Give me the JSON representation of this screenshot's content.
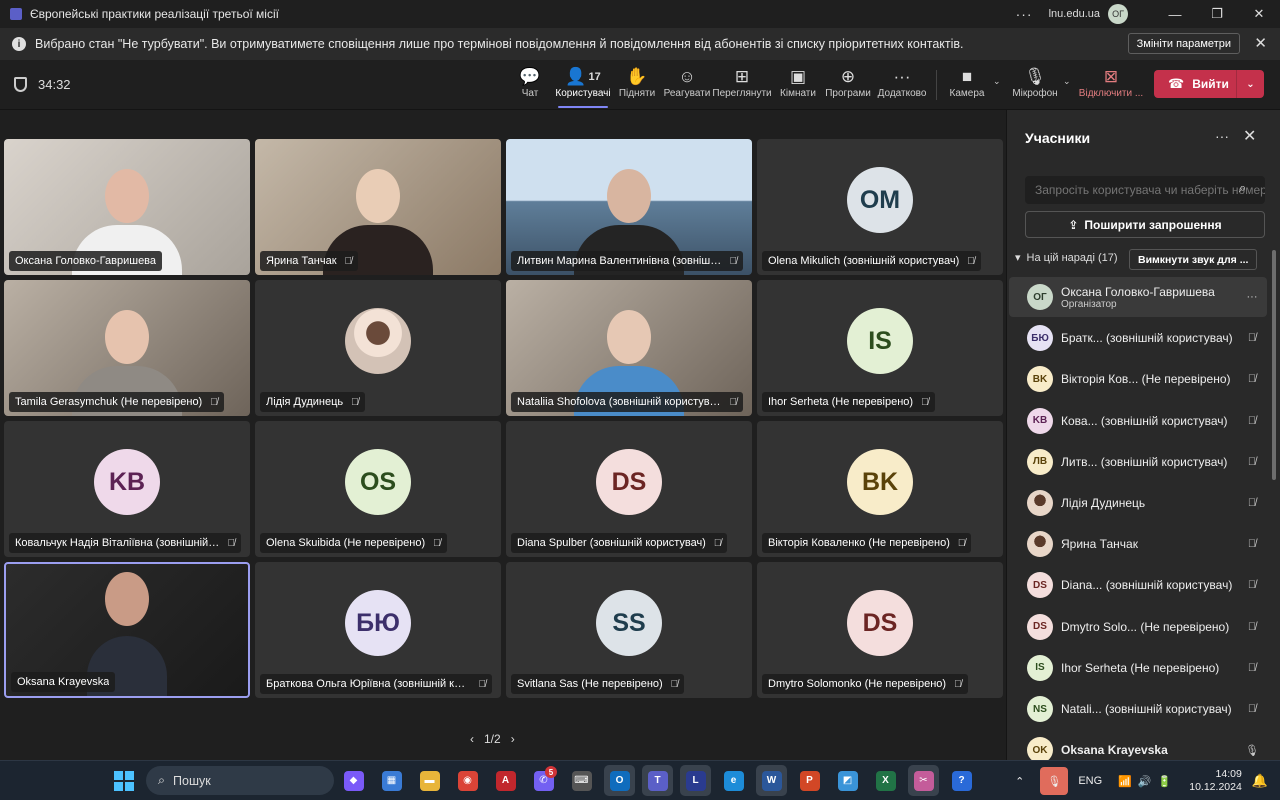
{
  "window": {
    "title": "Європейські практики реалізації третьої місії",
    "more": "···",
    "domain": "lnu.edu.ua",
    "user_initials": "ОГ",
    "minimize": "—",
    "maximize": "❐",
    "close": "✕"
  },
  "notice": {
    "icon": "info-icon",
    "text": "Вибрано стан \"Не турбувати\". Ви отримуватимете сповіщення лише про термінові повідомлення й повідомлення від абонентів зі списку пріоритетних контактів.",
    "change_button": "Змініти параметри",
    "close": "✕"
  },
  "toolbar": {
    "timer": "34:32",
    "buttons": [
      {
        "icon": "chat-icon",
        "glyph": "💬",
        "label": "Чат"
      },
      {
        "icon": "people-icon",
        "glyph": "👤",
        "count": "17",
        "label": "Користувачі"
      },
      {
        "icon": "raise-hand-icon",
        "glyph": "✋",
        "label": "Підняти"
      },
      {
        "icon": "react-icon",
        "glyph": "☺",
        "label": "Реагувати"
      },
      {
        "icon": "view-icon",
        "glyph": "⊞",
        "label": "Переглянути"
      },
      {
        "icon": "rooms-icon",
        "glyph": "▣",
        "label": "Кімнати"
      },
      {
        "icon": "apps-icon",
        "glyph": "⊕",
        "label": "Програми"
      },
      {
        "icon": "more-icon",
        "glyph": "···",
        "label": "Додатково"
      },
      {
        "icon": "camera-icon",
        "glyph": "■",
        "label": "Камера"
      },
      {
        "icon": "mic-icon",
        "glyph": "🎙",
        "label": "Мікрофон"
      },
      {
        "icon": "share-off-icon",
        "glyph": "⊠",
        "label": "Відключити ..."
      }
    ],
    "leave": {
      "icon": "phone-icon",
      "glyph": "☎",
      "label": "Вийти",
      "caret": "⌄"
    },
    "caret": "⌄"
  },
  "tiles": [
    {
      "name": "Оксана Головко-Гавришева",
      "type": "video",
      "mic": "",
      "speaking": false
    },
    {
      "name": "Ярина Танчак",
      "type": "video",
      "mic": "muted",
      "speaking": false
    },
    {
      "name": "Литвин Марина Валентинівна (зовнішні...",
      "type": "video",
      "mic": "muted",
      "speaking": false
    },
    {
      "name": "Olena Mikulich (зовнішній користувач)",
      "type": "avatar",
      "initials": "OM",
      "bg": "#dde3e8",
      "fg": "#1f3d4d",
      "mic": "muted",
      "speaking": false
    },
    {
      "name": "Tamila Gerasymchuk (Не перевірено)",
      "type": "video",
      "mic": "muted",
      "speaking": false
    },
    {
      "name": "Лідія Дудинець",
      "type": "photo",
      "mic": "muted",
      "speaking": false
    },
    {
      "name": "Nataliia Shofolova (зовнішній користувач)",
      "type": "video",
      "mic": "muted",
      "speaking": false
    },
    {
      "name": "Ihor Serheta (Не перевірено)",
      "type": "avatar",
      "initials": "IS",
      "bg": "#e3f0d4",
      "fg": "#2c4d1d",
      "mic": "muted",
      "speaking": false
    },
    {
      "name": "Ковальчук Надія Віталіївна (зовнішній к...",
      "type": "avatar",
      "initials": "KB",
      "bg": "#efd9ea",
      "fg": "#5c2254",
      "mic": "muted",
      "speaking": false
    },
    {
      "name": "Olena Skuibida (Не перевірено)",
      "type": "avatar",
      "initials": "OS",
      "bg": "#e3f0d4",
      "fg": "#2c4d1d",
      "mic": "muted",
      "speaking": false
    },
    {
      "name": "Diana Spulber (зовнішній користувач)",
      "type": "avatar",
      "initials": "DS",
      "bg": "#f4dedd",
      "fg": "#6b2523",
      "mic": "muted",
      "speaking": false
    },
    {
      "name": "Вікторія Коваленко (Не перевірено)",
      "type": "avatar",
      "initials": "BK",
      "bg": "#f8ecc9",
      "fg": "#5a4209",
      "mic": "muted",
      "speaking": false
    },
    {
      "name": "Oksana Krayevska",
      "type": "video",
      "mic": "",
      "speaking": true
    },
    {
      "name": "Браткова Ольга Юріївна (зовнішній кор...",
      "type": "avatar",
      "initials": "БЮ",
      "bg": "#e6e2f4",
      "fg": "#3c2f6b",
      "mic": "muted",
      "speaking": false
    },
    {
      "name": "Svitlana Sas (Не перевірено)",
      "type": "avatar",
      "initials": "SS",
      "bg": "#dde3e8",
      "fg": "#1f3d4d",
      "mic": "muted",
      "speaking": false
    },
    {
      "name": "Dmytro Solomonko (Не перевірено)",
      "type": "avatar",
      "initials": "DS",
      "bg": "#f4dedd",
      "fg": "#6b2523",
      "mic": "muted",
      "speaking": false
    }
  ],
  "pager": {
    "prev": "‹",
    "text": "1/2",
    "next": "›"
  },
  "panel": {
    "title": "Учасники",
    "more": "···",
    "close": "✕",
    "search_placeholder": "Запросіть користувача чи наберіть номер",
    "search_icon": "⌕",
    "share_icon": "⇪",
    "share_label": "Поширити запрошення",
    "group_caret": "▾",
    "group_label": "На цій нараді (17)",
    "mute_all": "Вимкнути звук для ...",
    "participants": [
      {
        "initials": "ОГ",
        "name": "Оксана Головко-Гавришева",
        "role": "Організатор",
        "bg": "#c9d8c9",
        "fg": "#2d3d2d",
        "action": "···",
        "hl": true
      },
      {
        "initials": "БЮ",
        "name": "Братк... (зовнішній користувач)",
        "role": "",
        "bg": "#e6e2f4",
        "fg": "#3c2f6b",
        "action": "mic-off"
      },
      {
        "initials": "BK",
        "name": "Вікторія Ков... (Не перевірено)",
        "role": "",
        "bg": "#f8ecc9",
        "fg": "#5a4209",
        "action": "mic-off"
      },
      {
        "initials": "KB",
        "name": "Кова... (зовнішній користувач)",
        "role": "",
        "bg": "#efd9ea",
        "fg": "#5c2254",
        "action": "mic-off"
      },
      {
        "initials": "ЛВ",
        "name": "Литв... (зовнішній користувач)",
        "role": "",
        "bg": "#f8ecc9",
        "fg": "#5a4209",
        "action": "mic-off"
      },
      {
        "initials": "",
        "name": "Лідія Дудинець",
        "role": "",
        "bg": "",
        "fg": "",
        "img": true,
        "action": "mic-off"
      },
      {
        "initials": "",
        "name": "Ярина Танчак",
        "role": "",
        "bg": "",
        "fg": "",
        "img": true,
        "action": "mic-off"
      },
      {
        "initials": "DS",
        "name": "Diana... (зовнішній користувач)",
        "role": "",
        "bg": "#f4dedd",
        "fg": "#6b2523",
        "action": "mic-off"
      },
      {
        "initials": "DS",
        "name": "Dmytro Solo... (Не перевірено)",
        "role": "",
        "bg": "#f4dedd",
        "fg": "#6b2523",
        "action": "mic-off"
      },
      {
        "initials": "IS",
        "name": "Ihor Serheta (Не перевірено)",
        "role": "",
        "bg": "#e3f0d4",
        "fg": "#2c4d1d",
        "action": "mic-off"
      },
      {
        "initials": "NS",
        "name": "Natali... (зовнішній користувач)",
        "role": "",
        "bg": "#e3f0d4",
        "fg": "#2c4d1d",
        "action": "mic-off"
      },
      {
        "initials": "OK",
        "name": "Oksana Krayevska",
        "role": "",
        "bg": "#f8ecc9",
        "fg": "#5a4209",
        "action": "mic-on",
        "bold": true
      }
    ]
  },
  "taskbar": {
    "search_icon": "⌕",
    "search": "Пошук",
    "apps": [
      {
        "name": "copilot-app",
        "glyph": "◆",
        "color": "#7a5af8"
      },
      {
        "name": "store-app",
        "glyph": "▦",
        "color": "#3a7bd5"
      },
      {
        "name": "explorer-app",
        "glyph": "▬",
        "color": "#e8b53a"
      },
      {
        "name": "chrome-app",
        "glyph": "◉",
        "color": "#db4437"
      },
      {
        "name": "acrobat-app",
        "glyph": "A",
        "color": "#c1272d"
      },
      {
        "name": "viber-app",
        "glyph": "✆",
        "color": "#7360f2",
        "badge": "5"
      },
      {
        "name": "keyboard-app",
        "glyph": "⌨",
        "color": "#555"
      },
      {
        "name": "outlook-app",
        "glyph": "O",
        "color": "#0f6cbd",
        "on": true
      },
      {
        "name": "teams-app",
        "glyph": "T",
        "color": "#5b5fc7",
        "on": true
      },
      {
        "name": "l-app",
        "glyph": "L",
        "color": "#2a3b8f",
        "on": true
      },
      {
        "name": "edge-app",
        "glyph": "e",
        "color": "#1d8cd8"
      },
      {
        "name": "word-app",
        "glyph": "W",
        "color": "#2b579a",
        "on": true
      },
      {
        "name": "powerpoint-app",
        "glyph": "P",
        "color": "#d24726"
      },
      {
        "name": "photos-app",
        "glyph": "◩",
        "color": "#3a94d8"
      },
      {
        "name": "excel-app",
        "glyph": "X",
        "color": "#217346"
      },
      {
        "name": "snip-app",
        "glyph": "✂",
        "color": "#c45c9a",
        "on": true
      },
      {
        "name": "help-app",
        "glyph": "?",
        "color": "#2a6ad8"
      }
    ],
    "tray_up": "⌃",
    "lang": "ENG",
    "sys": "📶🔊🔋",
    "time": "14:09",
    "date": "10.12.2024",
    "bell": "🔔"
  }
}
